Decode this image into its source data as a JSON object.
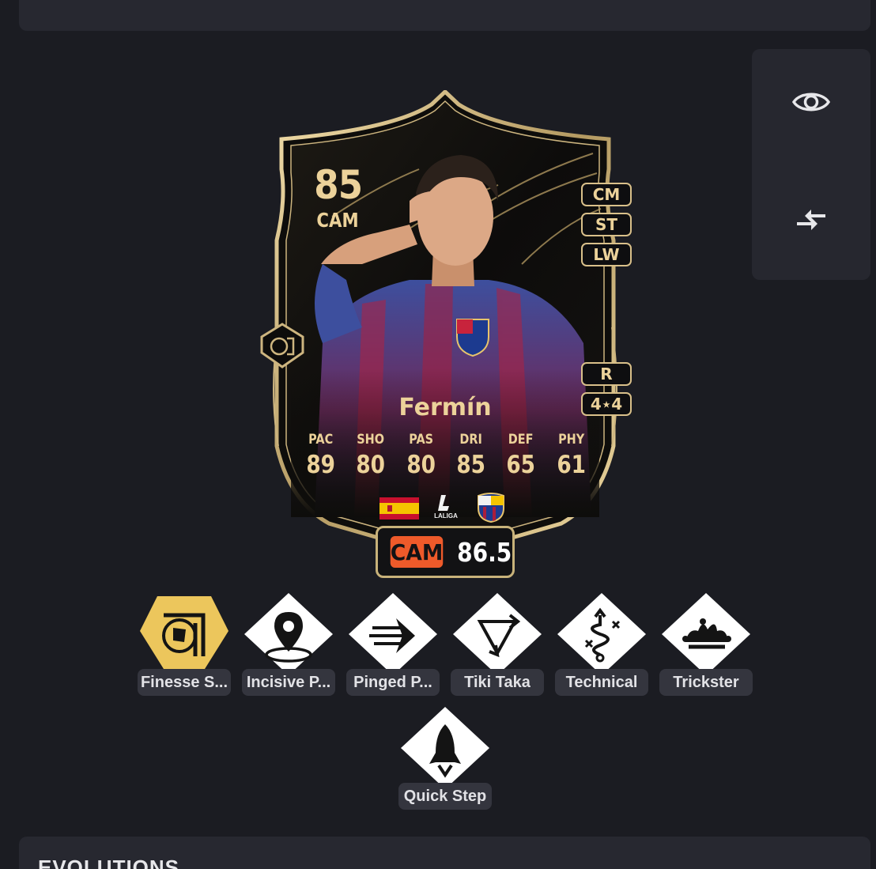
{
  "card": {
    "rating": "85",
    "position": "CAM",
    "alt_positions": [
      "CM",
      "ST",
      "LW"
    ],
    "foot": "R",
    "skills_weakfoot": "4⋆4",
    "name": "Fermín",
    "stat_labels": [
      "PAC",
      "SHO",
      "PAS",
      "DRI",
      "DEF",
      "PHY"
    ],
    "stat_values": [
      "89",
      "80",
      "80",
      "85",
      "65",
      "61"
    ],
    "league_text": "LALIGA"
  },
  "chemistry_badge": {
    "position": "CAM",
    "value": "86.5"
  },
  "playstyles": [
    {
      "label": "Finesse S...",
      "icon": "finesse-shot-icon",
      "plus": true
    },
    {
      "label": "Incisive P...",
      "icon": "incisive-pass-icon",
      "plus": false
    },
    {
      "label": "Pinged P...",
      "icon": "pinged-pass-icon",
      "plus": false
    },
    {
      "label": "Tiki Taka",
      "icon": "tiki-taka-icon",
      "plus": false
    },
    {
      "label": "Technical",
      "icon": "technical-icon",
      "plus": false
    },
    {
      "label": "Trickster",
      "icon": "trickster-icon",
      "plus": false
    },
    {
      "label": "Quick Step",
      "icon": "quick-step-icon",
      "plus": false
    }
  ],
  "sections": {
    "evolutions_title": "EVOLUTIONS"
  },
  "colors": {
    "background": "#1b1c22",
    "panel": "#272830",
    "gold": "#ecd29a",
    "accent_orange": "#ee5a2a"
  }
}
